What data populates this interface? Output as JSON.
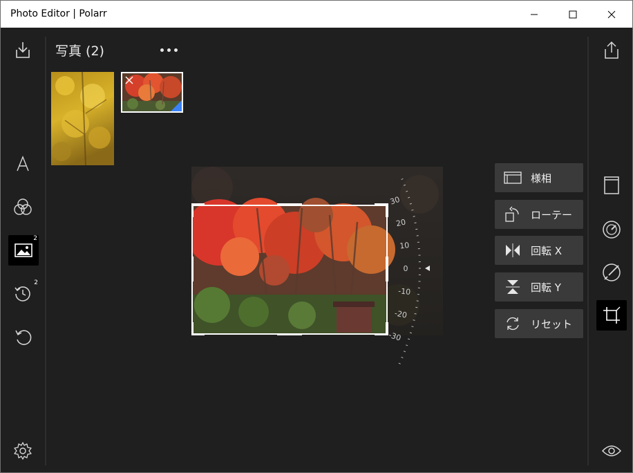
{
  "window": {
    "title": "Photo Editor | Polarr",
    "controls": [
      "minimize",
      "maximize",
      "close"
    ]
  },
  "left_rail": {
    "items": [
      {
        "name": "import-icon"
      },
      {
        "name": "text-icon"
      },
      {
        "name": "filters-icon"
      },
      {
        "name": "image-icon",
        "badge": "2",
        "active": true
      },
      {
        "name": "history-icon",
        "badge": "2"
      },
      {
        "name": "undo-icon"
      },
      {
        "name": "settings-icon"
      }
    ]
  },
  "photos": {
    "title": "写真 (2)",
    "count": 2
  },
  "tools": [
    {
      "label": "様相",
      "icon": "aspect-icon"
    },
    {
      "label": "ローテー",
      "icon": "rotate-icon"
    },
    {
      "label": "回転 X",
      "icon": "flip-x-icon"
    },
    {
      "label": "回転 Y",
      "icon": "flip-y-icon"
    },
    {
      "label": "リセット",
      "icon": "reset-icon"
    }
  ],
  "dial": {
    "ticks": [
      "30",
      "20",
      "10",
      "0",
      "-10",
      "-20",
      "-30"
    ],
    "current": "0"
  },
  "right_rail": {
    "items": [
      {
        "name": "share-icon"
      },
      {
        "name": "frame-icon"
      },
      {
        "name": "adjust-dial-icon"
      },
      {
        "name": "brush-icon"
      },
      {
        "name": "crop-icon",
        "active": true
      },
      {
        "name": "preview-eye-icon"
      }
    ]
  },
  "colors": {
    "background": "#1f1f1f",
    "button": "#3a3a3a",
    "accent_corner": "#3b82f6",
    "active_rail": "#000000"
  }
}
